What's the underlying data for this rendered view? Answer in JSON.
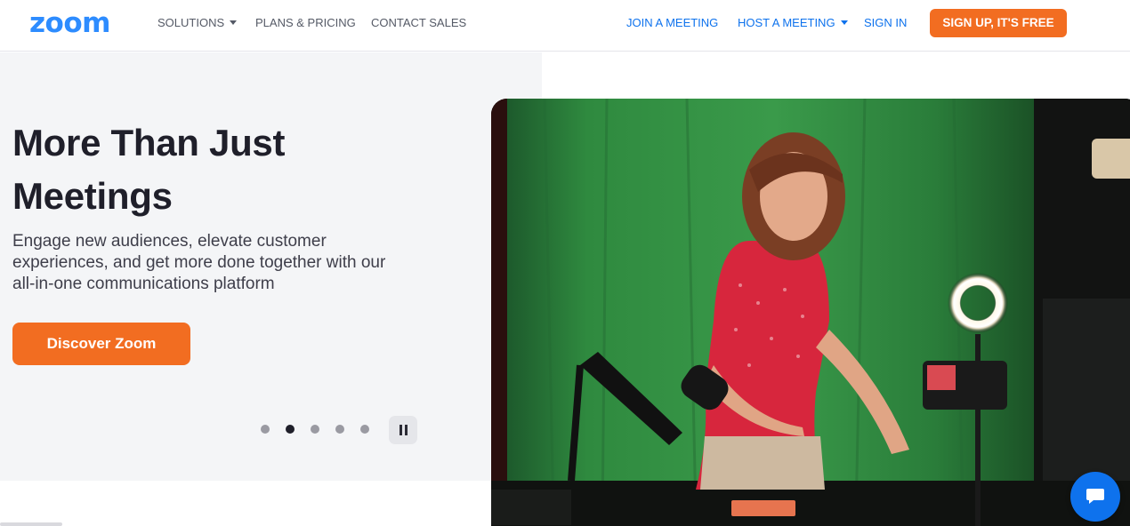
{
  "header": {
    "logo_text": "zoom",
    "nav_left": [
      {
        "label": "SOLUTIONS",
        "has_caret": true
      },
      {
        "label": "PLANS & PRICING",
        "has_caret": false
      },
      {
        "label": "CONTACT SALES",
        "has_caret": false
      }
    ],
    "nav_right": [
      {
        "label": "JOIN A MEETING",
        "has_caret": false
      },
      {
        "label": "HOST A MEETING",
        "has_caret": true
      },
      {
        "label": "SIGN IN",
        "has_caret": false
      }
    ],
    "signup_label": "SIGN UP, IT'S FREE"
  },
  "hero": {
    "headline_line1": "More Than Just",
    "headline_line2": "Meetings",
    "subtext_line1": "Engage new audiences, elevate customer",
    "subtext_line2": "experiences, and get more done together with our",
    "subtext_line3": "all-in-one communications platform",
    "cta_label": "Discover Zoom",
    "carousel": {
      "slide_count": 5,
      "active_index": 1
    }
  },
  "colors": {
    "brand_blue": "#2d8cff",
    "nav_blue": "#0e72ed",
    "accent_orange": "#f26d21",
    "hero_bg": "#f4f5f7",
    "headline": "#1f1f2a"
  },
  "icons": {
    "solutions_caret": "chevron-down-icon",
    "host_caret": "chevron-down-icon",
    "pause": "pause-icon",
    "chat": "chat-bubble-icon"
  }
}
